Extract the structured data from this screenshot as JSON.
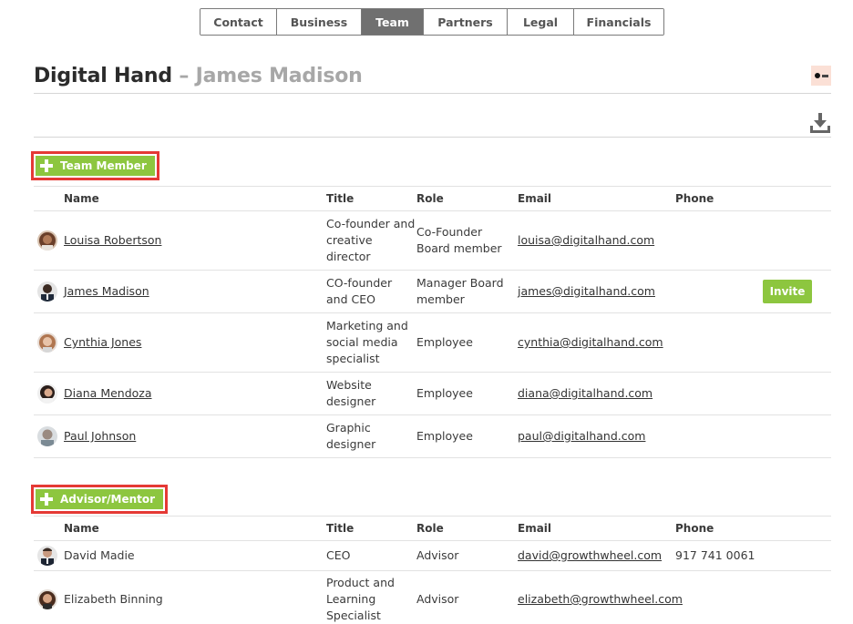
{
  "tabs": [
    {
      "label": "Contact"
    },
    {
      "label": "Business"
    },
    {
      "label": "Team",
      "active": true
    },
    {
      "label": "Partners"
    },
    {
      "label": "Legal"
    },
    {
      "label": "Financials"
    }
  ],
  "header": {
    "company": "Digital Hand",
    "separator": " – ",
    "person": "James Madison"
  },
  "colors": {
    "accent_green": "#8dc63f",
    "highlight_red": "#e53935",
    "active_tab": "#707070",
    "subtitle_gray": "#a7a7a7",
    "logo_bg": "#fbe0d6"
  },
  "icons": {
    "download": "download-icon",
    "add": "plus-icon",
    "logo": "company-logo"
  },
  "team_section": {
    "add_label": "Team Member",
    "columns": {
      "name": "Name",
      "title": "Title",
      "role": "Role",
      "email": "Email",
      "phone": "Phone"
    },
    "rows": [
      {
        "name": "Louisa Robertson",
        "title": "Co-founder and creative director",
        "role": "Co-Founder Board member",
        "email": "louisa@digitalhand.com",
        "phone": "",
        "invite": ""
      },
      {
        "name": "James Madison",
        "title": "CO-founder and CEO",
        "role": "Manager Board member",
        "email": "james@digitalhand.com",
        "phone": "",
        "invite": "Invite"
      },
      {
        "name": "Cynthia Jones",
        "title": "Marketing and social media specialist",
        "role": "Employee",
        "email": "cynthia@digitalhand.com",
        "phone": "",
        "invite": ""
      },
      {
        "name": "Diana Mendoza",
        "title": "Website designer",
        "role": "Employee",
        "email": "diana@digitalhand.com",
        "phone": "",
        "invite": ""
      },
      {
        "name": "Paul Johnson",
        "title": "Graphic designer",
        "role": "Employee",
        "email": "paul@digitalhand.com",
        "phone": "",
        "invite": ""
      }
    ]
  },
  "advisor_section": {
    "add_label": "Advisor/Mentor",
    "columns": {
      "name": "Name",
      "title": "Title",
      "role": "Role",
      "email": "Email",
      "phone": "Phone"
    },
    "rows": [
      {
        "name": "David Madie",
        "title": "CEO",
        "role": "Advisor",
        "email": "david@growthwheel.com",
        "phone": "917 741 0061"
      },
      {
        "name": "Elizabeth Binning",
        "title": "Product and Learning Specialist",
        "role": "Advisor",
        "email": "elizabeth@growthwheel.com",
        "phone": ""
      }
    ]
  }
}
